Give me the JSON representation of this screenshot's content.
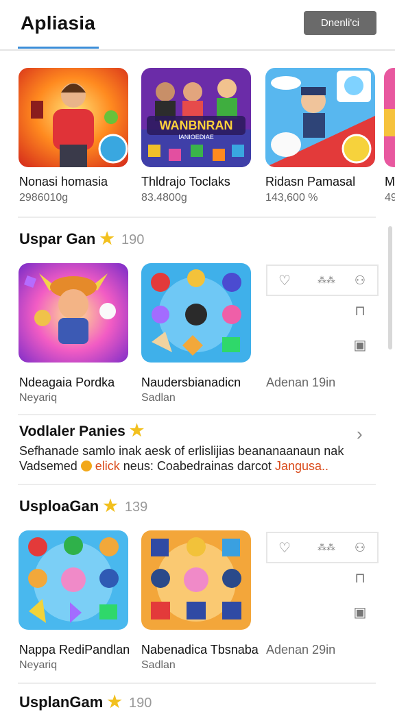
{
  "header": {
    "title": "Apliasia",
    "button_label": "Dnenli'ci"
  },
  "top_row": [
    {
      "title": "Nonasi homasia",
      "sub": "2986010g"
    },
    {
      "title": "Thldrajo Toclaks",
      "sub": "83.4800g",
      "art_text_1": "WANBNRAN",
      "art_text_2": "IANIOEDIAE"
    },
    {
      "title": "Ridasn Pamasal",
      "sub": "143,600 %"
    },
    {
      "title": "M",
      "sub": "49"
    }
  ],
  "section1": {
    "title": "Uspar Gan",
    "count": "190",
    "cards": [
      {
        "title": "Ndeagaia Pordka",
        "sub": "Neyariq"
      },
      {
        "title": "Naudersbianadicn",
        "sub": "Sadlan"
      }
    ],
    "side_label": "Adenan 19in",
    "icons": {
      "heart": "♡",
      "rating": "⁂⁂",
      "user": "⚇",
      "lock": "⊓",
      "square": "▣"
    }
  },
  "promo": {
    "title": "Vodlaler Panies",
    "line1": "Sefhanade samlo inak aesk of erlislijias beananaanaun nak",
    "line2_a": "Vadsemed",
    "line2_link1": "elick",
    "line2_b": "neus: Coabedrainas darcot",
    "line2_link2": "Jangusa.."
  },
  "section2": {
    "title": "UsploaGan",
    "count": "139",
    "cards": [
      {
        "title": "Nappa RediPandlan",
        "sub": "Neyariq"
      },
      {
        "title": "Nabenadica Tbsnaba",
        "sub": "Sadlan"
      }
    ],
    "side_label": "Adenan 29in"
  },
  "section3": {
    "title": "UsplanGam",
    "count": "190"
  },
  "colors": {
    "accent": "#3c8ed8",
    "star": "#f2c01e",
    "link": "#d94a1a"
  }
}
